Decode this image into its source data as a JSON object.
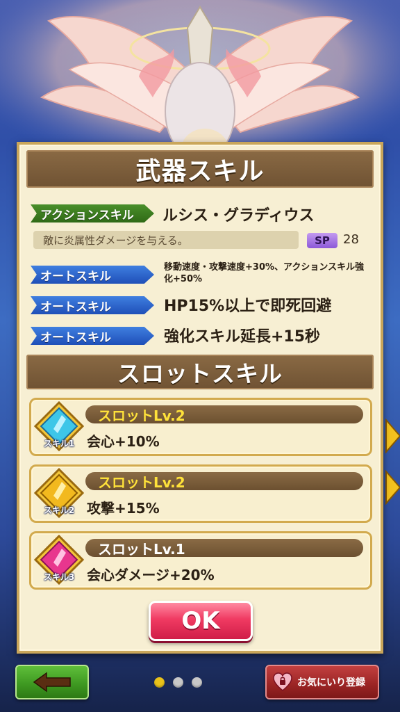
{
  "dialog": {
    "title": "武器スキル",
    "action_skill": {
      "tag": "アクションスキル",
      "name": "ルシス・グラディウス",
      "description": "敵に炎属性ダメージを与える。",
      "sp_label": "SP",
      "sp_value": "28"
    },
    "auto_skills": [
      {
        "tag": "オートスキル",
        "text": "移動速度・攻撃速度+30%、アクションスキル強化+50%"
      },
      {
        "tag": "オートスキル",
        "text": "HP15%以上で即死回避"
      },
      {
        "tag": "オートスキル",
        "text": "強化スキル延長+15秒"
      }
    ],
    "slot_title": "スロットスキル",
    "slots": [
      {
        "level": "スロットLv.2",
        "effect": "会心+10%",
        "icon_label": "スキル1",
        "icon": "cyan-gem-icon"
      },
      {
        "level": "スロットLv.2",
        "effect": "攻撃+15%",
        "icon_label": "スキル2",
        "icon": "gold-gem-icon"
      },
      {
        "level": "スロットLv.1",
        "effect": "会心ダメージ+20%",
        "icon_label": "スキル3",
        "icon": "pink-gem-icon"
      }
    ],
    "ok_label": "OK"
  },
  "bottom": {
    "favorite_label": "お気にいり登録",
    "page_count": 3,
    "active_page": 1
  },
  "colors": {
    "panel": "#f7efd3",
    "header": "#7a5b3a",
    "action_tag": "#3f7f22",
    "auto_tag": "#2a5fd0",
    "ok": "#e8305a",
    "back": "#46a22a",
    "favorite": "#a52a2a",
    "slot_lv2": "#ffe23a"
  }
}
